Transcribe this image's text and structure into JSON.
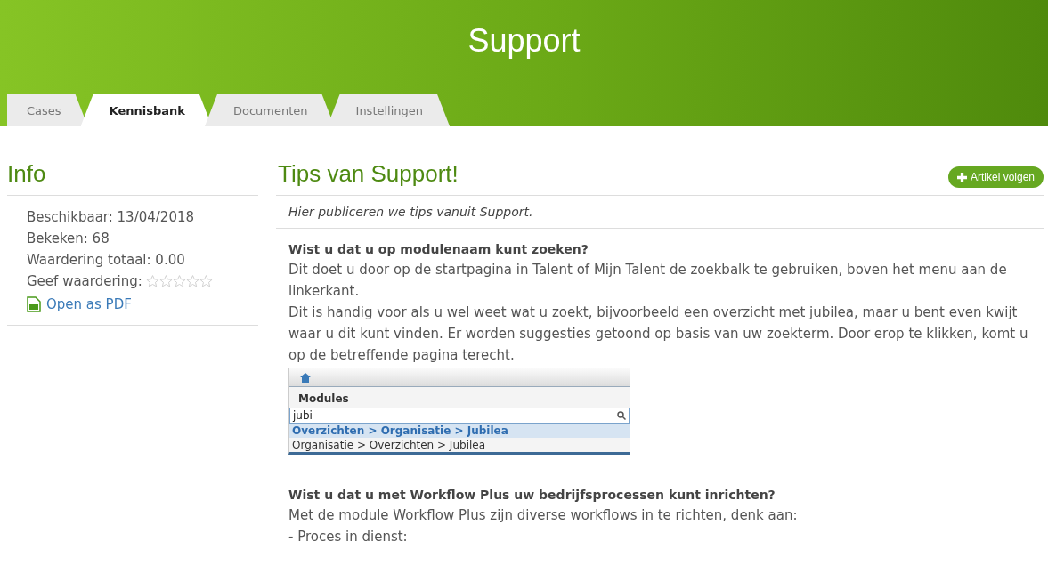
{
  "header": {
    "title": "Support"
  },
  "tabs": [
    {
      "label": "Cases",
      "selected": false
    },
    {
      "label": "Kennisbank",
      "selected": true
    },
    {
      "label": "Documenten",
      "selected": false
    },
    {
      "label": "Instellingen",
      "selected": false
    }
  ],
  "sidebar": {
    "title": "Info",
    "lines": [
      "Beschikbaar: 13/04/2018",
      "Bekeken: 68",
      "Waardering totaal: 0.00"
    ],
    "rating": {
      "label": "Geef waardering:",
      "stars": 0
    },
    "pdf_link": "Open as PDF"
  },
  "article": {
    "title": "Tips van Support!",
    "follow_button": "Artikel volgen",
    "intro": "Hier publiceren we tips vanuit Support.",
    "sections": [
      {
        "heading": "Wist u dat u op modulenaam kunt zoeken?",
        "paragraphs": [
          "Dit doet u door op de startpagina in Talent of Mijn Talent de zoekbalk te gebruiken, boven het menu aan de linkerkant.",
          "Dit is handig voor als u wel weet wat u zoekt, bijvoorbeeld een overzicht met jubilea, maar u bent even kwijt waar u dit kunt vinden. Er worden suggesties getoond op basis van uw zoekterm. Door erop te klikken, komt u op de betreffende pagina terecht."
        ],
        "screenshot": {
          "title": "Modules",
          "search_value": "jubi",
          "results": [
            {
              "label": "Overzichten > Organisatie > Jubilea",
              "selected": true
            },
            {
              "label": "Organisatie > Overzichten > Jubilea",
              "selected": false
            }
          ]
        }
      },
      {
        "heading": "Wist u dat u met Workflow Plus uw bedrijfsprocessen kunt inrichten?",
        "paragraphs": [
          "Met de module Workflow Plus zijn diverse workflows in te richten, denk aan:",
          "- Proces in dienst:"
        ]
      }
    ]
  }
}
